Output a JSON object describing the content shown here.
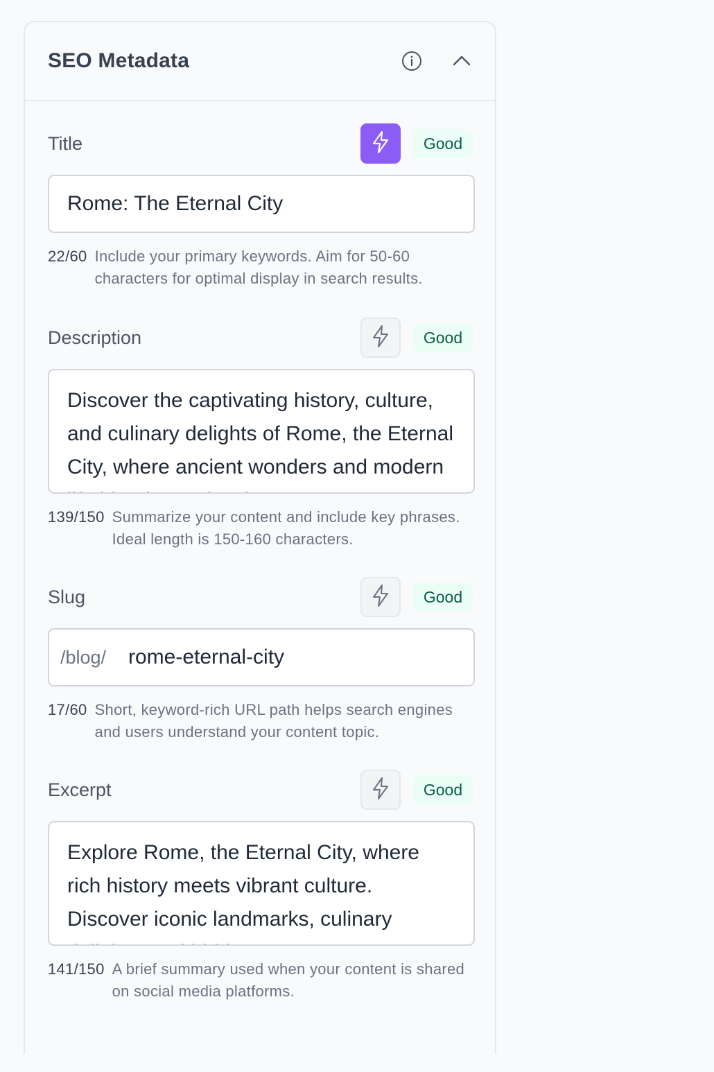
{
  "panel": {
    "title": "SEO Metadata",
    "info_icon": "info-circle-icon",
    "collapse_icon": "chevron-up-icon"
  },
  "colors": {
    "accent": "#8b5cf6",
    "good_bg": "#ecfdf5",
    "good_text": "#065f46"
  },
  "fields": {
    "title": {
      "label": "Title",
      "status": "Good",
      "value": "Rome: The Eternal City",
      "count": "22/60",
      "help": "Include your primary keywords. Aim for 50-60 characters for optimal display in search results."
    },
    "description": {
      "label": "Description",
      "status": "Good",
      "value": "Discover the captivating history, culture, and culinary delights of Rome, the Eternal City, where ancient wonders and modern life blend seamlessly.",
      "count": "139/150",
      "help": "Summarize your content and include key phrases. Ideal length is 150-160 characters."
    },
    "slug": {
      "label": "Slug",
      "status": "Good",
      "prefix": "/blog/",
      "value": "rome-eternal-city",
      "count": "17/60",
      "help": "Short, keyword-rich URL path helps search engines and users understand your content topic."
    },
    "excerpt": {
      "label": "Excerpt",
      "status": "Good",
      "value": "Explore Rome, the Eternal City, where rich history meets vibrant culture. Discover iconic landmarks, culinary delights, and hidden gems.",
      "count": "141/150",
      "help": "A brief summary used when your content is shared on social media platforms."
    }
  }
}
